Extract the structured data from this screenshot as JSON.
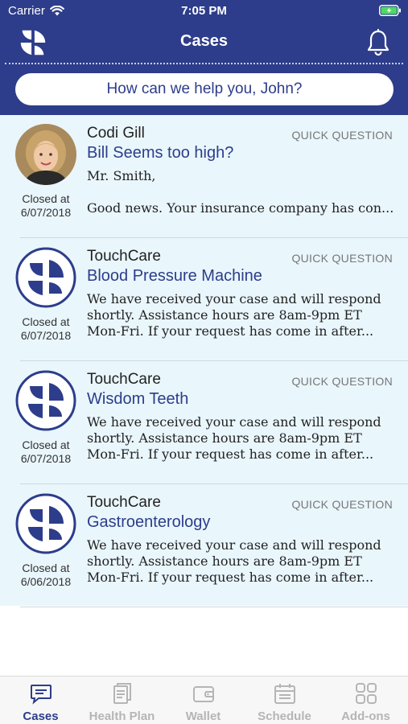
{
  "status_bar": {
    "carrier": "Carrier",
    "time": "7:05 PM"
  },
  "header": {
    "title": "Cases",
    "help_prompt": "How can we help you, John?"
  },
  "cases": [
    {
      "sender": "Codi Gill",
      "tag": "QUICK QUESTION",
      "subject": "Bill Seems too high?",
      "preview": [
        "Mr. Smith,",
        "",
        "Good news. Your insurance company has con..."
      ],
      "closed_label": "Closed at",
      "closed_date": "6/07/2018",
      "avatar": "person-photo"
    },
    {
      "sender": "TouchCare",
      "tag": "QUICK QUESTION",
      "subject": "Blood Pressure Machine",
      "preview": [
        "We have received your case and will respond",
        "shortly. Assistance hours are 8am-9pm ET",
        "Mon-Fri. If your request has come in after..."
      ],
      "closed_label": "Closed at",
      "closed_date": "6/07/2018",
      "avatar": "touchcare-logo"
    },
    {
      "sender": "TouchCare",
      "tag": "QUICK QUESTION",
      "subject": "Wisdom Teeth",
      "preview": [
        "We have received your case and will respond",
        "shortly. Assistance hours are 8am-9pm ET",
        "Mon-Fri. If your request has come in after..."
      ],
      "closed_label": "Closed at",
      "closed_date": "6/07/2018",
      "avatar": "touchcare-logo"
    },
    {
      "sender": "TouchCare",
      "tag": "QUICK QUESTION",
      "subject": "Gastroenterology",
      "preview": [
        "We have received your case and will respond",
        "shortly. Assistance hours are 8am-9pm ET",
        "Mon-Fri. If your request has come in after..."
      ],
      "closed_label": "Closed at",
      "closed_date": "6/06/2018",
      "avatar": "touchcare-logo"
    }
  ],
  "tabs": [
    {
      "label": "Cases",
      "icon": "chat-bubble-icon",
      "active": true
    },
    {
      "label": "Health Plan",
      "icon": "document-icon",
      "active": false
    },
    {
      "label": "Wallet",
      "icon": "wallet-icon",
      "active": false
    },
    {
      "label": "Schedule",
      "icon": "calendar-icon",
      "active": false
    },
    {
      "label": "Add-ons",
      "icon": "grid-icon",
      "active": false
    }
  ],
  "colors": {
    "brand": "#2d3d8b",
    "list_background": "#e9f6fc",
    "tab_inactive": "#b5b5b5",
    "battery": "#4cd964"
  }
}
